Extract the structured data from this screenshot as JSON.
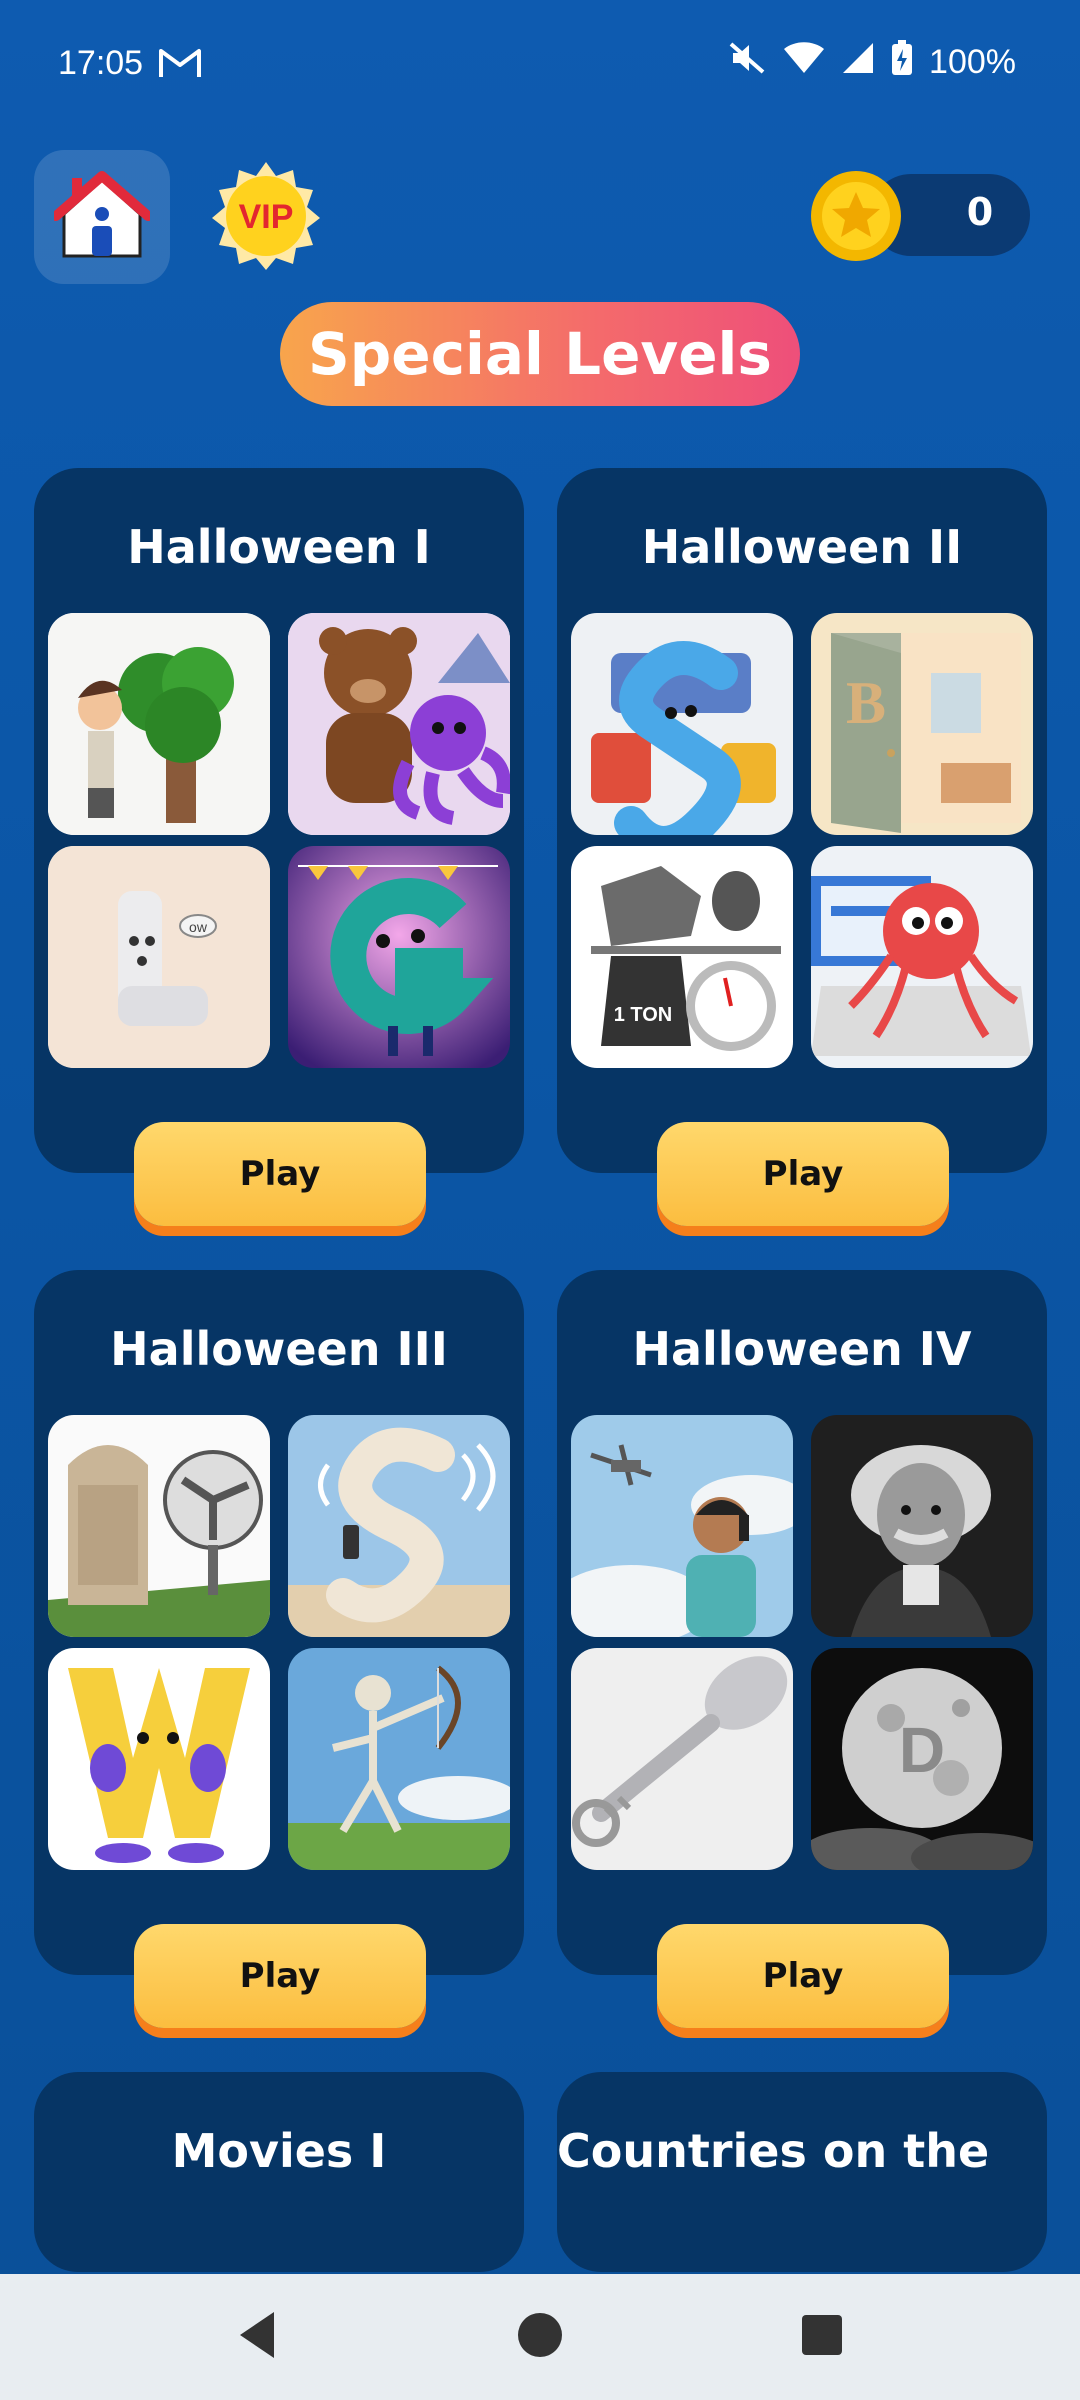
{
  "status_bar": {
    "time": "17:05",
    "battery": "100%"
  },
  "header": {
    "vip_label": "VIP",
    "coins": "0",
    "page_title": "Special Levels"
  },
  "cards": [
    {
      "title": "Halloween I",
      "play_label": "Play"
    },
    {
      "title": "Halloween II",
      "play_label": "Play"
    },
    {
      "title": "Halloween III",
      "play_label": "Play"
    },
    {
      "title": "Halloween IV",
      "play_label": "Play"
    },
    {
      "title": "Movies I"
    },
    {
      "title": "Countries on the"
    }
  ],
  "tiles": {
    "c2_scale_text": "1 TON",
    "c1_bubble": "ow",
    "c2_door_letter": "B",
    "c4_moon_letter": "D"
  },
  "colors": {
    "background": "#0b56a6",
    "card": "#063565",
    "accent_orange": "#f57f1b",
    "play_yellow": "#fbbd3f"
  }
}
